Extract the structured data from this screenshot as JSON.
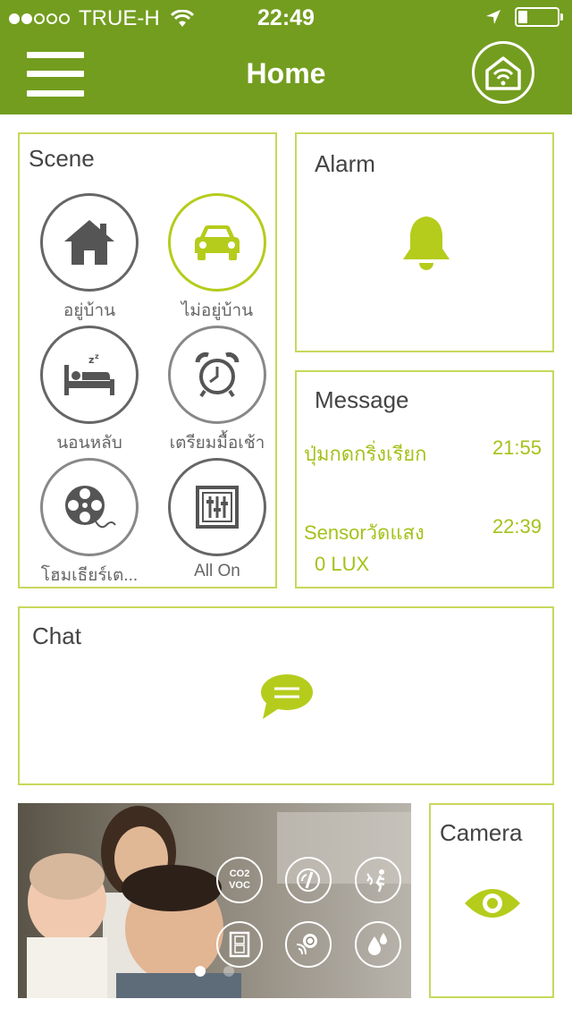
{
  "status_bar": {
    "carrier": "TRUE-H",
    "time": "22:49"
  },
  "header": {
    "title": "Home"
  },
  "scene": {
    "title": "Scene",
    "items": [
      {
        "label": "อยู่บ้าน",
        "icon": "house-icon"
      },
      {
        "label": "ไม่อยู่บ้าน",
        "icon": "car-icon"
      },
      {
        "label": "นอนหลับ",
        "icon": "bed-icon"
      },
      {
        "label": "เตรียมมื้อเช้า",
        "icon": "alarm-clock-icon"
      },
      {
        "label": "โฮมเธียร์เต...",
        "icon": "film-reel-icon"
      },
      {
        "label": "All On",
        "icon": "sliders-icon"
      }
    ]
  },
  "alarm": {
    "title": "Alarm"
  },
  "message": {
    "title": "Message",
    "rows": [
      {
        "text": "ปุ่มกดกริ่งเรียก",
        "time": "21:55"
      },
      {
        "text": "Sensorวัดแสง",
        "time": "22:39",
        "value": "0 LUX"
      }
    ]
  },
  "chat": {
    "title": "Chat"
  },
  "sensors": {
    "items": [
      {
        "label": "CO2 VOC",
        "icon": "co2-voc-icon"
      },
      {
        "icon": "thermometer-icon"
      },
      {
        "icon": "motion-sensor-icon"
      },
      {
        "icon": "door-sensor-icon"
      },
      {
        "icon": "smoke-sensor-icon"
      },
      {
        "icon": "water-leak-icon"
      }
    ]
  },
  "camera": {
    "title": "Camera"
  },
  "colors": {
    "brand_green": "#739d1f",
    "accent_lime": "#b5cc1c"
  }
}
